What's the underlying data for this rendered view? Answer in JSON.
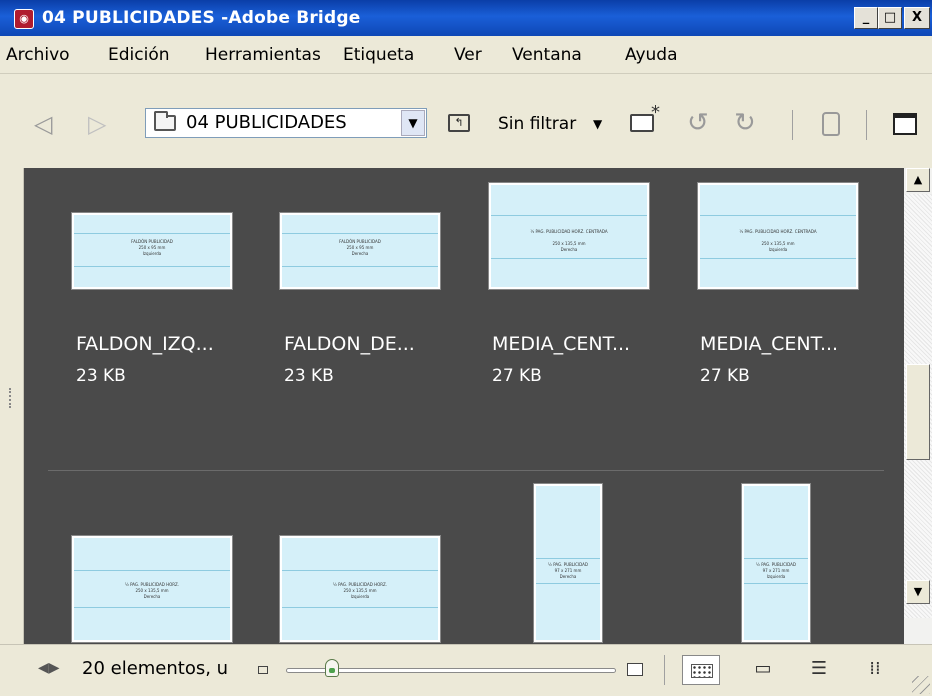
{
  "window": {
    "title": "04 PUBLICIDADES -Adobe Bridge",
    "min_label": "_",
    "max_label": "□",
    "close_label": "X"
  },
  "menu": [
    {
      "label": "Archivo"
    },
    {
      "label": "Edición"
    },
    {
      "label": "Herramientas"
    },
    {
      "label": "Etiqueta"
    },
    {
      "label": "Ver"
    },
    {
      "label": "Ventana"
    },
    {
      "label": "Ayuda"
    }
  ],
  "toolbar": {
    "back_icon": "back-arrow-icon",
    "forward_icon": "forward-arrow-icon",
    "path_folder": "04 PUBLICIDADES",
    "filter_label": "Sin filtrar",
    "icons": [
      "folder-icon",
      "go-up-icon",
      "new-folder-icon",
      "rotate-left-icon",
      "rotate-right-icon",
      "trash-icon",
      "compact-mode-icon"
    ]
  },
  "content": {
    "background": "#4a4a4a",
    "items": [
      {
        "name": "FALDON_IZQ...",
        "size": "23 KB",
        "thumb_title": "FALDÓN PUBLICIDAD",
        "thumb_sub": "250 x 95 mm",
        "thumb_side": "Izquierda"
      },
      {
        "name": "FALDON_DE...",
        "size": "23 KB",
        "thumb_title": "FALDÓN PUBLICIDAD",
        "thumb_sub": "250 x 95 mm",
        "thumb_side": "Derecha"
      },
      {
        "name": "MEDIA_CENT...",
        "size": "27 KB",
        "thumb_title": "½ PAG. PUBLICIDAD HORZ. CENTRADA",
        "thumb_sub": "250 x 135,5 mm",
        "thumb_side": "Derecha"
      },
      {
        "name": "MEDIA_CENT...",
        "size": "27 KB",
        "thumb_title": "½ PAG. PUBLICIDAD HORZ. CENTRADA",
        "thumb_sub": "250 x 135,5 mm",
        "thumb_side": "Izquierda"
      }
    ],
    "row2": [
      {
        "thumb_title": "½ PAG. PUBLICIDAD HORZ.",
        "thumb_sub": "250 x 135,5 mm",
        "thumb_side": "Derecha"
      },
      {
        "thumb_title": "½ PAG. PUBLICIDAD HORZ.",
        "thumb_sub": "250 x 135,5 mm",
        "thumb_side": "Izquierda"
      },
      {
        "thumb_title": "½ PAG. PUBLICIDAD",
        "thumb_sub": "97 x 271 mm",
        "thumb_side": "Derecha"
      },
      {
        "thumb_title": "½ PAG. PUBLICIDAD",
        "thumb_sub": "97 x 271 mm",
        "thumb_side": "Izquierda"
      }
    ]
  },
  "status": {
    "text": "20 elementos, u",
    "zoom_level": 0.15,
    "view_icons": [
      "thumbnail-view-icon",
      "filmstrip-view-icon",
      "list-view-icon",
      "details-view-icon"
    ]
  }
}
